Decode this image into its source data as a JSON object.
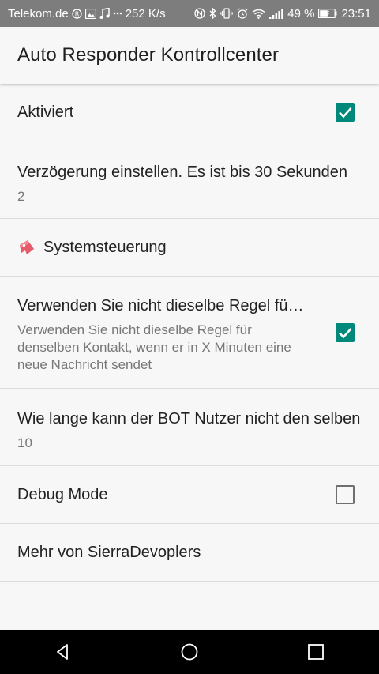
{
  "status_bar": {
    "carrier": "Telekom.de",
    "speed": "252 K/s",
    "battery": "49 %",
    "time": "23:51",
    "icons": [
      "r-circle-icon",
      "image-icon",
      "music-icon",
      "more-dots-icon",
      "nfc-icon",
      "bluetooth-icon",
      "vibrate-icon",
      "alarm-icon",
      "wifi-icon",
      "signal-icon",
      "battery-icon"
    ]
  },
  "app_bar": {
    "title": "Auto Responder Kontrollcenter"
  },
  "settings": {
    "activated": {
      "title": "Aktiviert",
      "checked": true
    },
    "delay": {
      "title": "Verzögerung einstellen. Es ist bis 30 Sekunden",
      "summary": "2"
    },
    "category": {
      "title": "Systemsteuerung",
      "icon": "bookmark-icon"
    },
    "same_rule": {
      "title": "Verwenden Sie nicht dieselbe Regel für denselben Kontakt",
      "summary": "Verwenden Sie nicht dieselbe Regel für denselben Kontakt, wenn er in X Minuten eine neue Nachricht sendet",
      "checked": true
    },
    "bot_limit": {
      "title": "Wie lange kann der BOT Nutzer nicht den selben",
      "summary": "10"
    },
    "debug": {
      "title": "Debug Mode",
      "checked": false
    },
    "more": {
      "title": "Mehr von SierraDevoplers"
    }
  },
  "nav_bar": {
    "icons": [
      "back-icon",
      "home-icon",
      "recents-icon"
    ]
  },
  "colors": {
    "accent": "#00897b",
    "status_bar": "#7d7d7d",
    "background": "#f7f7f7"
  }
}
